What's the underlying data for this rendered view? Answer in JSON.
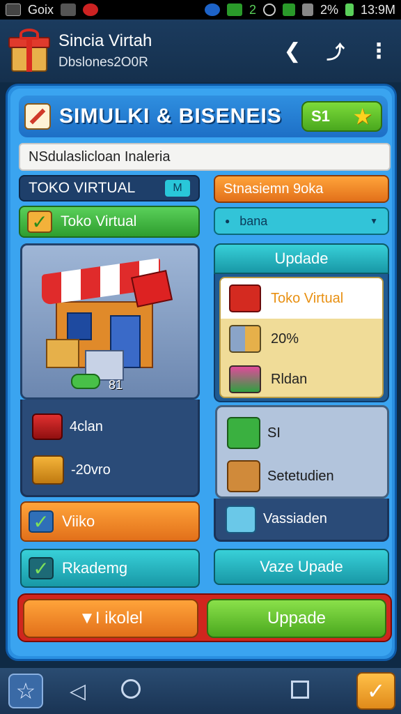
{
  "status_bar": {
    "left_text": "Goix",
    "center_text": "2",
    "battery": "2%",
    "time": "13:9M"
  },
  "app_bar": {
    "title": "Sincia Virtah",
    "subtitle": "Dbslones2O0R",
    "icons": [
      "gift-icon",
      "back-icon",
      "share-icon",
      "more-icon"
    ]
  },
  "panel": {
    "title": "SIMULKI & BISENEIS",
    "coin_label": "S1",
    "search_value": "NSdulaslicloan Inaleria",
    "left": {
      "store_label": "TOKO VIRTUAL",
      "store_tag": "M",
      "toko_button": "Toko Virtual",
      "card_count": "81",
      "stat1": "4clan",
      "stat2": "-20vro",
      "orange_button": "Viiko",
      "teal_button": "Rkademg"
    },
    "right": {
      "orange_button": "Stnasiemn 9oka",
      "dropdown_value": "bana",
      "update_header": "Updade",
      "update_items": [
        "Toko Virtual",
        "20%",
        "Rldan"
      ],
      "item1": "SI",
      "item2": "Setetudien",
      "item3": "Vassiaden",
      "teal_button": "Vaze Upade"
    },
    "bottom": {
      "left_button": "▼I ikolel",
      "right_button": "Uppade"
    }
  },
  "colors": {
    "panel_blue": "#2a8fe0",
    "orange": "#e2701a",
    "green": "#4aa81e",
    "teal": "#1898a6"
  }
}
